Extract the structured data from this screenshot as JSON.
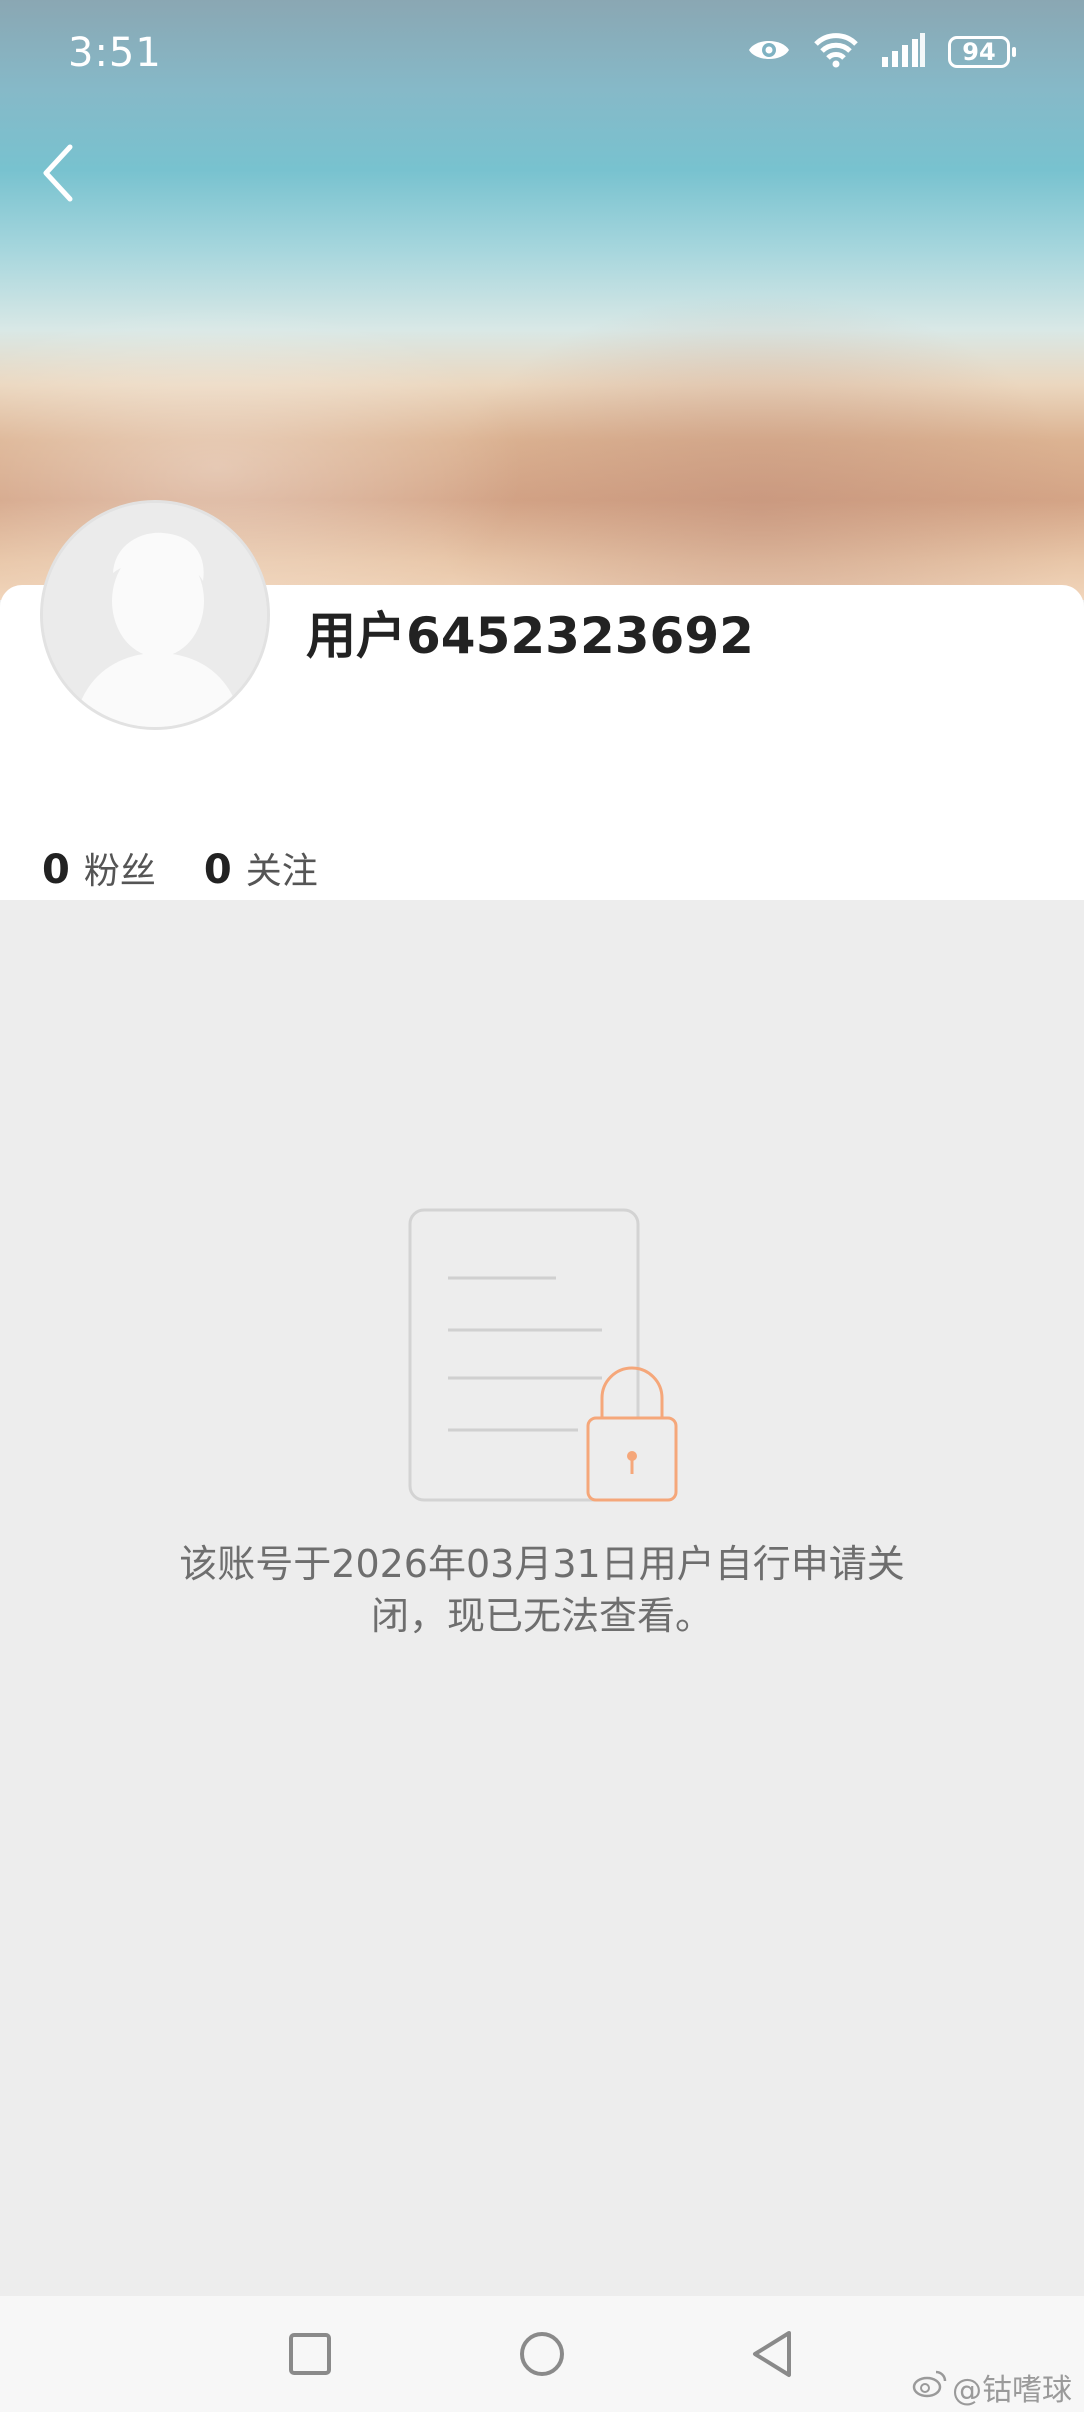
{
  "status_bar": {
    "time": "3:51",
    "battery": "94"
  },
  "profile": {
    "username": "用户6452323692",
    "stats": [
      {
        "count": "0",
        "label": "粉丝"
      },
      {
        "count": "0",
        "label": "关注"
      }
    ]
  },
  "empty_state": {
    "line1": "该账号于2026年03月31日用户自行申请关",
    "line2": "闭，现已无法查看。",
    "lock_color": "#f5a77a"
  },
  "watermark": {
    "text": "@钴嗜球"
  },
  "icons": {
    "back": "chevron-left-icon",
    "eye": "eye-icon",
    "wifi": "wifi-icon",
    "signal": "signal-icon",
    "battery": "battery-icon",
    "nav_recent": "square-icon",
    "nav_home": "circle-icon",
    "nav_back": "triangle-back-icon"
  }
}
